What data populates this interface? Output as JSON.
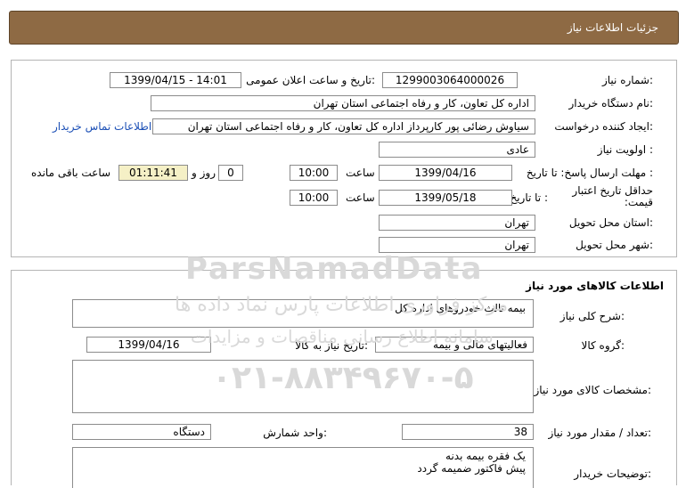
{
  "header": {
    "title": "جزئیات اطلاعات نیاز"
  },
  "need_info": {
    "need_number_label": "شماره نیاز:",
    "need_number": "1299003064000026",
    "announce_label": "تاریخ و ساعت اعلان عمومی:",
    "announce_value": "1399/04/15 - 14:01",
    "buyer_org_label": "نام دستگاه خریدار:",
    "buyer_org": "اداره کل تعاون، کار و رفاه اجتماعی استان تهران",
    "requester_label": "ایجاد کننده درخواست:",
    "requester": "سیاوش  رضائی پور کارپرداز اداره کل تعاون، کار و رفاه اجتماعی استان تهران",
    "buyer_contact_link": "اطلاعات تماس خریدار",
    "priority_label": "اولویت نیاز :",
    "priority": "عادی",
    "deadline_label": "مهلت ارسال پاسخ:  تا تاریخ :",
    "deadline_date": "1399/04/16",
    "time_label": "ساعت",
    "deadline_time": "10:00",
    "days_value": "0",
    "days_label": "روز و",
    "remaining_time": "01:11:41",
    "remaining_label": "ساعت باقی مانده",
    "price_validity_label": "حداقل تاریخ اعتبار قیمت:",
    "until_date_label": "تا تاریخ :",
    "validity_date": "1399/05/18",
    "validity_time": "10:00",
    "province_label": "استان محل تحویل:",
    "province": "تهران",
    "city_label": "شهر محل تحویل:",
    "city": "تهران"
  },
  "goods_info": {
    "section_title": "اطلاعات کالاهای مورد نیاز",
    "summary_label": "شرح کلی نیاز:",
    "summary": "بیمه ثالث خودروهای اداره کل",
    "group_label": "گروه کالا:",
    "group": "فعالیتهای مالی و بیمه",
    "need_date_label": "تاریخ نیاز به کالا:",
    "need_date": "1399/04/16",
    "specs_label": "مشخصات کالای مورد نیاز:",
    "specs": "",
    "quantity_label": "تعداد / مقدار مورد نیاز:",
    "quantity": "38",
    "unit_label": "واحد شمارش:",
    "unit": "دستگاه",
    "buyer_notes_label": "توضیحات خریدار:",
    "buyer_notes_line1": "یک فقره بیمه بدنه",
    "buyer_notes_line2": "پیش فاکتور ضمیمه گردد"
  },
  "watermark": {
    "brand": "ParsNamadData",
    "line1": "مرکز فراوری اطلاعات پارس نماد داده ها",
    "line2": "سامانه اطلاع رسانی مناقصات و مزایدات",
    "phone": "۰۲۱-۸۸۳۴۹۶۷۰-۵"
  }
}
